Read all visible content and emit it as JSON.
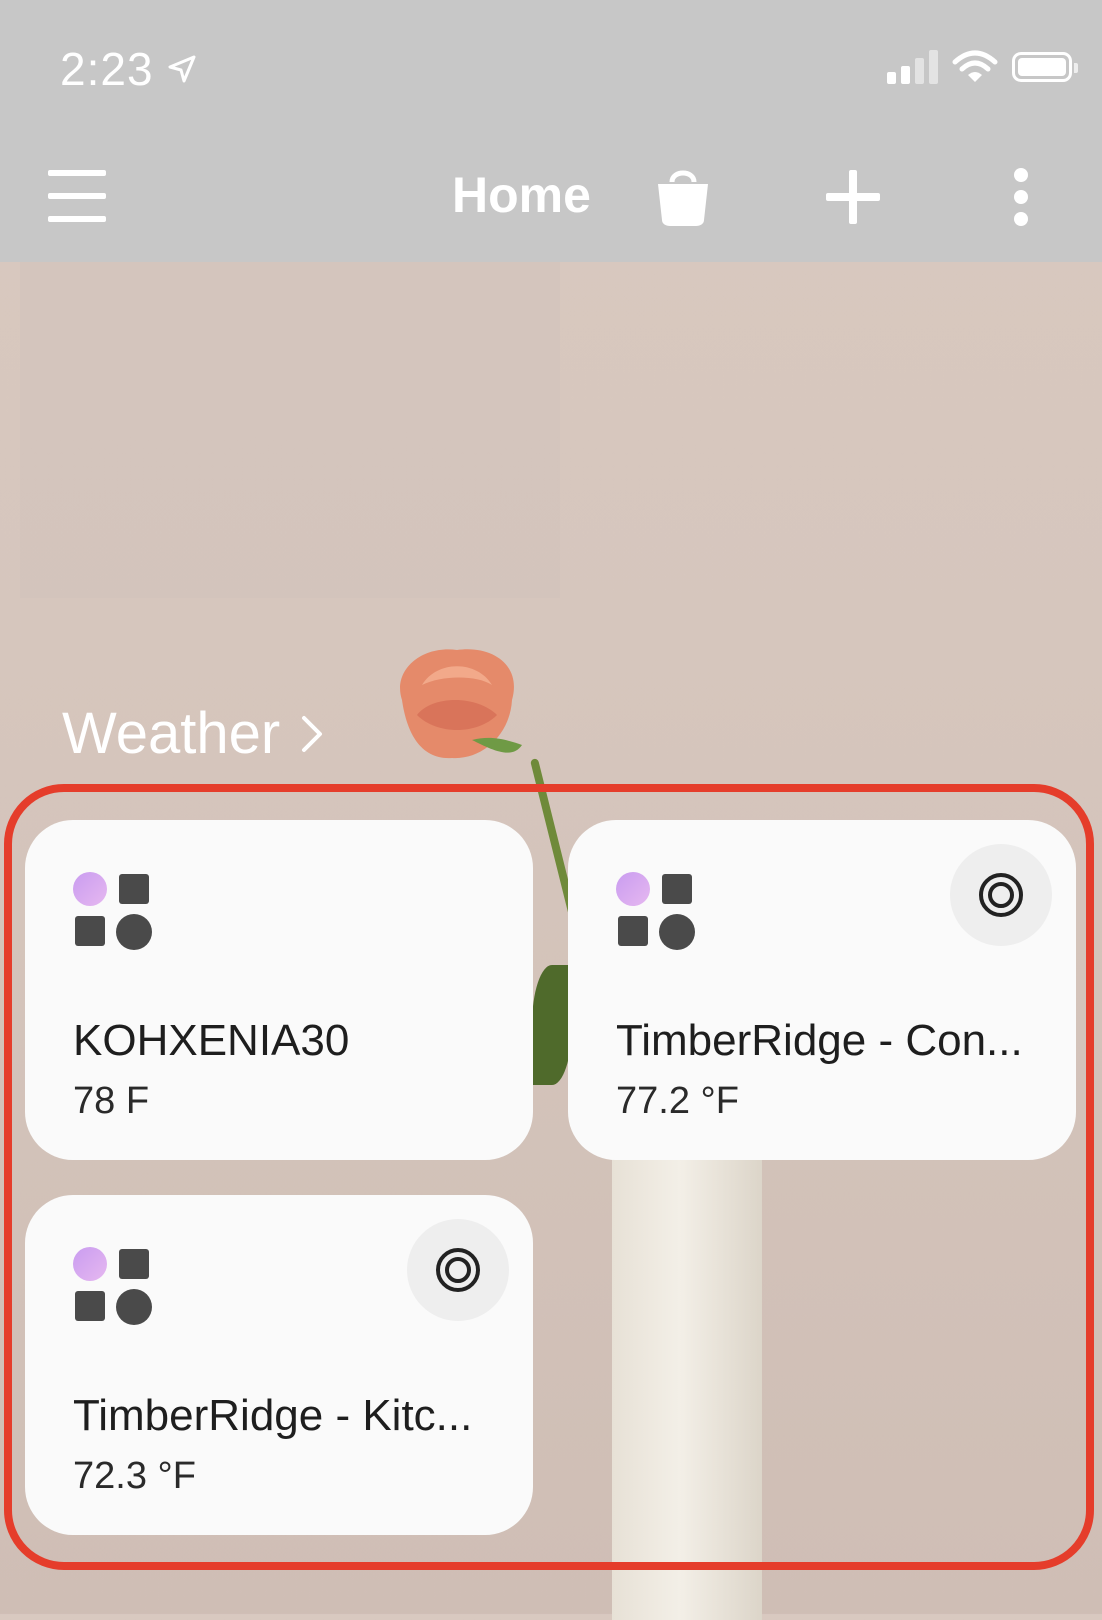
{
  "status_bar": {
    "time": "2:23",
    "icons": [
      "location-arrow-icon",
      "signal-icon",
      "wifi-icon",
      "battery-icon"
    ]
  },
  "nav_bar": {
    "title": "Home",
    "icons": [
      "menu-icon",
      "shopping-bag-icon",
      "plus-icon",
      "more-vertical-icon"
    ]
  },
  "section": {
    "title": "Weather"
  },
  "colors": {
    "highlight_border": "#e53d2b",
    "card_background": "#fafafa",
    "icon_gradient_start": "#c99cf0",
    "icon_gradient_end": "#e6b8f0",
    "icon_dark": "#4a4a4a"
  },
  "cards": [
    {
      "name": "KOHXENIA30",
      "value": "78 F",
      "has_action": false
    },
    {
      "name": "TimberRidge - Con...",
      "value": "77.2 °F",
      "has_action": true
    },
    {
      "name": "TimberRidge - Kitc...",
      "value": "72.3 °F",
      "has_action": true
    }
  ]
}
